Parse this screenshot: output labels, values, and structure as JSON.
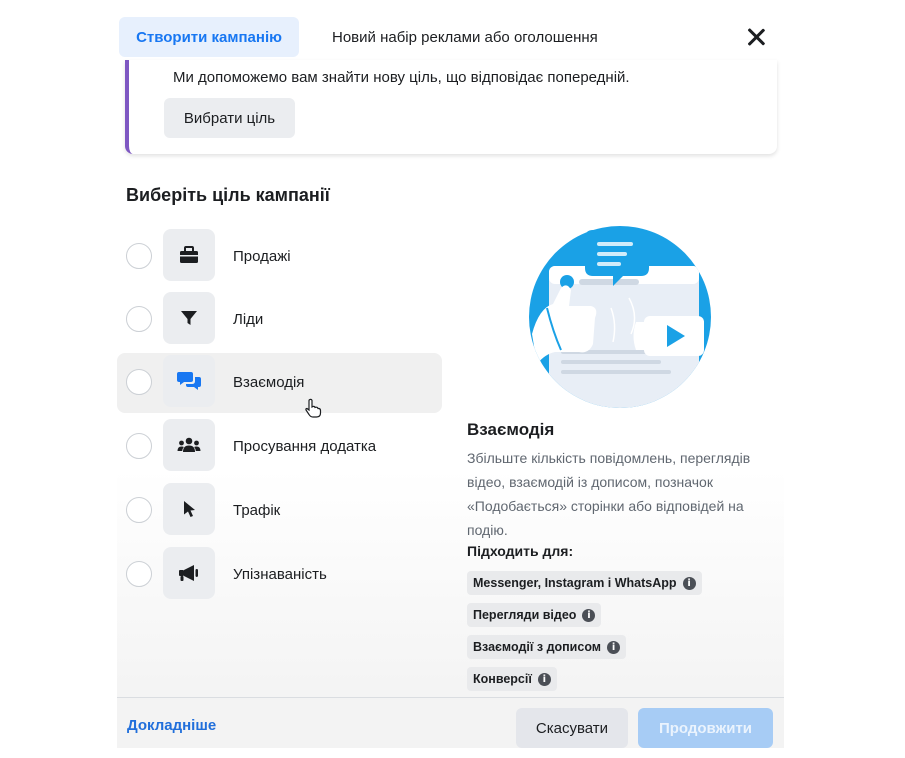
{
  "header": {
    "tab_active": "Створити кампанію",
    "tab_other": "Новий набір реклами або оголошення"
  },
  "hint": {
    "text": "Ми допоможемо вам знайти нову ціль, що відповідає попередній.",
    "button": "Вибрати ціль"
  },
  "section_title": "Виберіть ціль кампанії",
  "objectives": [
    {
      "label": "Продажі",
      "icon": "briefcase-icon"
    },
    {
      "label": "Ліди",
      "icon": "filter-icon"
    },
    {
      "label": "Взаємодія",
      "icon": "chat-bubbles-icon"
    },
    {
      "label": "Просування додатка",
      "icon": "people-icon"
    },
    {
      "label": "Трафік",
      "icon": "pointer-icon"
    },
    {
      "label": "Упізнаваність",
      "icon": "megaphone-icon"
    }
  ],
  "hovered_objective": "Взаємодія",
  "detail": {
    "title": "Взаємодія",
    "description": "Збільште кількість повідомлень, переглядів відео, взаємодій із дописом, позначок «Подобається» сторінки або відповідей на подію.",
    "fits_title": "Підходить для:",
    "chips": [
      "Messenger, Instagram і WhatsApp",
      "Перегляди відео",
      "Взаємодії з дописом",
      "Конверсії"
    ]
  },
  "footer": {
    "learn_more": "Докладніше",
    "cancel": "Скасувати",
    "continue": "Продовжити"
  },
  "colors": {
    "accent": "#1877f2",
    "hint_border": "#7e57c2",
    "continue_disabled": "#a7ccf5",
    "illustration_blue": "#1aa1e6"
  }
}
